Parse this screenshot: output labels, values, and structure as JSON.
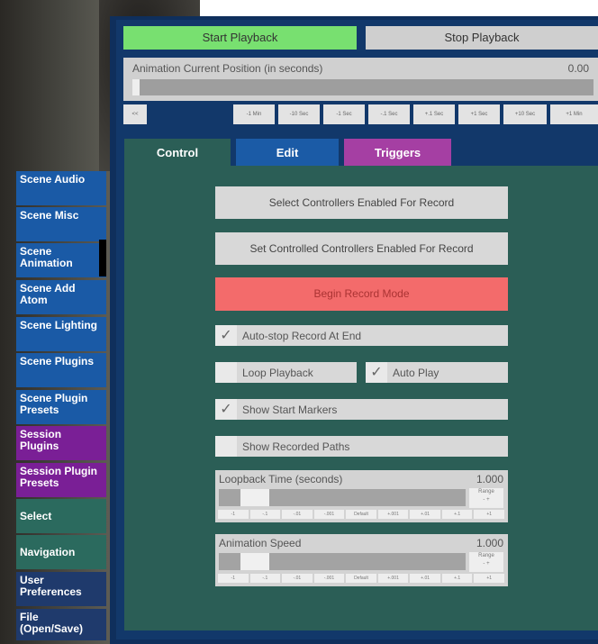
{
  "sidebar": {
    "items": [
      {
        "label": "Scene Audio",
        "style": "blue"
      },
      {
        "label": "Scene Misc",
        "style": "blue"
      },
      {
        "label": "Scene Animation",
        "style": "blue",
        "active": true
      },
      {
        "label": "Scene Add Atom",
        "style": "blue"
      },
      {
        "label": "Scene Lighting",
        "style": "blue"
      },
      {
        "label": "Scene Plugins",
        "style": "blue"
      },
      {
        "label": "Scene Plugin Presets",
        "style": "blue"
      },
      {
        "label": "Session Plugins",
        "style": "purple"
      },
      {
        "label": "Session Plugin Presets",
        "style": "purple"
      },
      {
        "label": "Select",
        "style": "teal"
      },
      {
        "label": "Navigation",
        "style": "teal"
      },
      {
        "label": "User Preferences",
        "style": "navy"
      },
      {
        "label": "File (Open/Save)",
        "style": "navy"
      }
    ]
  },
  "playback": {
    "start_label": "Start Playback",
    "stop_label": "Stop Playback"
  },
  "position": {
    "label": "Animation Current Position (in seconds)",
    "value": "0.00",
    "fraction": 0.0,
    "steps": [
      "<<",
      "-1 Min",
      "-10 Sec",
      "-1 Sec",
      "-.1 Sec",
      "+.1 Sec",
      "+1 Sec",
      "+10 Sec",
      "+1 Min"
    ]
  },
  "tabs": [
    {
      "label": "Control",
      "active": true
    },
    {
      "label": "Edit"
    },
    {
      "label": "Triggers"
    }
  ],
  "control": {
    "select_controllers_label": "Select Controllers Enabled For Record",
    "set_controlled_label": "Set Controlled Controllers Enabled For Record",
    "begin_record_label": "Begin Record Mode",
    "auto_stop": {
      "label": "Auto-stop Record At End",
      "checked": true
    },
    "loop_playback": {
      "label": "Loop Playback",
      "checked": false
    },
    "auto_play": {
      "label": "Auto Play",
      "checked": true
    },
    "show_start_markers": {
      "label": "Show Start Markers",
      "checked": true
    },
    "show_recorded_paths": {
      "label": "Show Recorded Paths",
      "checked": false
    },
    "loopback_time": {
      "label": "Loopback Time (seconds)",
      "value": "1.000",
      "fraction": 0.1,
      "range_label": "Range",
      "range_buttons": [
        "-",
        "+"
      ],
      "steps": [
        "-1",
        "-.1",
        "-.01",
        "-.001",
        "Default",
        "+.001",
        "+.01",
        "+.1",
        "+1"
      ]
    },
    "animation_speed": {
      "label": "Animation Speed",
      "value": "1.000",
      "fraction": 0.1,
      "range_label": "Range",
      "range_buttons": [
        "-",
        "+"
      ],
      "steps": [
        "-1",
        "-.1",
        "-.01",
        "-.001",
        "Default",
        "+.001",
        "+.01",
        "+.1",
        "+1"
      ]
    }
  },
  "colors": {
    "start_button": "#78e070",
    "record_button": "#f36b6b",
    "tab_control": "#2b5e56",
    "tab_edit": "#1b5ba6",
    "tab_triggers": "#a53fa3"
  }
}
